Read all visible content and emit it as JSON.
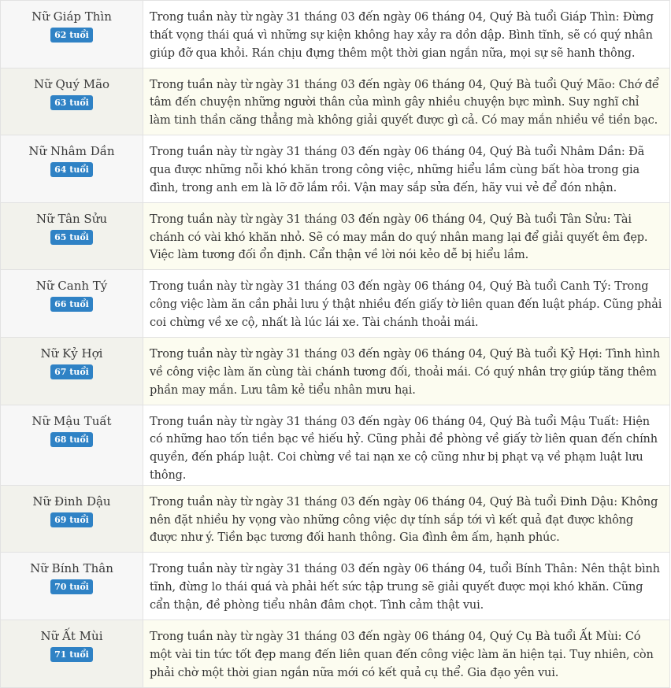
{
  "rows": [
    {
      "name": "Nữ Giáp Thìn",
      "age": "62 tuổi",
      "text": "Trong tuần này từ ngày 31 tháng 03 đến ngày 06 tháng 04, Quý Bà tuổi Giáp Thìn: Đừng thất vọng thái quá vì những sự kiện không hay xảy ra dồn dập. Bình tĩnh, sẽ có quý nhân giúp đỡ qua khỏi. Rán chịu đựng thêm một thời gian ngắn nữa, mọi sự sẽ hanh thông."
    },
    {
      "name": "Nữ Quý Mão",
      "age": "63 tuổi",
      "text": "Trong tuần này từ ngày 31 tháng 03 đến ngày 06 tháng 04, Quý Bà tuổi Quý Mão: Chớ để tâm đến chuyện những người thân của mình gây nhiều chuyện bực mình. Suy nghĩ chỉ làm tinh thần căng thẳng mà không giải quyết được gì cả. Có may mắn nhiều về tiền bạc."
    },
    {
      "name": "Nữ Nhâm Dần",
      "age": "64 tuổi",
      "text": "Trong tuần này từ ngày 31 tháng 03 đến ngày 06 tháng 04, Quý Bà tuổi Nhâm Dần: Đã qua được những nỗi khó khăn trong công việc, những hiểu lầm cùng bất hòa trong gia đình, trong anh em là lỡ đỡ lắm rồi. Vận may sắp sửa đến, hãy vui vẻ để đón nhận."
    },
    {
      "name": "Nữ Tân Sửu",
      "age": "65 tuổi",
      "text": "Trong tuần này từ ngày 31 tháng 03 đến ngày 06 tháng 04, Quý Bà tuổi Tân Sửu: Tài chánh có vài khó khăn nhỏ. Sẽ có may mắn do quý nhân mang lại để giải quyết êm đẹp. Việc làm tương đối ổn định. Cẩn thận về lời nói kẻo dễ bị hiểu lầm."
    },
    {
      "name": "Nữ Canh Tý",
      "age": "66 tuổi",
      "text": "Trong tuần này từ ngày 31 tháng 03 đến ngày 06 tháng 04, Quý Bà tuổi Canh Tý: Trong công việc làm ăn cần phải lưu ý thật nhiều đến giấy tờ liên quan đến luật pháp. Cũng phải coi chừng về xe cộ, nhất là lúc lái xe. Tài chánh thoải mái."
    },
    {
      "name": "Nữ Kỷ Hợi",
      "age": "67 tuổi",
      "text": "Trong tuần này từ ngày 31 tháng 03 đến ngày 06 tháng 04, Quý Bà tuổi Kỷ Hợi: Tình hình về công việc làm ăn cùng tài chánh tương đối, thoải mái. Có quý nhân trợ giúp tăng thêm phần may mắn. Lưu tâm kẻ tiểu nhân mưu hại."
    },
    {
      "name": "Nữ Mậu Tuất",
      "age": "68 tuổi",
      "text": "Trong tuần này từ ngày 31 tháng 03 đến ngày 06 tháng 04, Quý Bà tuổi Mậu Tuất: Hiện có những hao tốn tiền bạc về hiếu hỷ. Cũng phải đề phòng về giấy tờ liên quan đến chính quyền, đến pháp luật. Coi chừng về tai nạn xe cộ cũng như bị phạt vạ về phạm luật lưu thông."
    },
    {
      "name": "Nữ Đinh Dậu",
      "age": "69 tuổi",
      "text": "Trong tuần này từ ngày 31 tháng 03 đến ngày 06 tháng 04, Quý Bà tuổi Đinh Dậu: Không nên đặt nhiều hy vọng vào những công việc dự tính sắp tới vì kết quả đạt được không được như ý. Tiền bạc tương đối hanh thông. Gia đình êm ấm, hạnh phúc."
    },
    {
      "name": "Nữ Bính Thân",
      "age": "70 tuổi",
      "text": "Trong tuần này từ ngày 31 tháng 03 đến ngày 06 tháng 04, tuổi Bính Thân: Nên thật bình tĩnh, đừng lo thái quá và phải hết sức tập trung sẽ giải quyết được mọi khó khăn. Cũng cẩn thận, đề phòng tiểu nhân đâm chọt. Tình cảm thật vui."
    },
    {
      "name": "Nữ Ất Mùi",
      "age": "71 tuổi",
      "text": "Trong tuần này từ ngày 31 tháng 03 đến ngày 06 tháng 04, Quý Cụ Bà tuổi Ất Mùi: Có một vài tin tức tốt đẹp mang đến liên quan đến công việc làm ăn hiện tại. Tuy nhiên, còn phải chờ một thời gian ngắn nữa mới có kết quả cụ thể. Gia đạo yên vui."
    }
  ]
}
